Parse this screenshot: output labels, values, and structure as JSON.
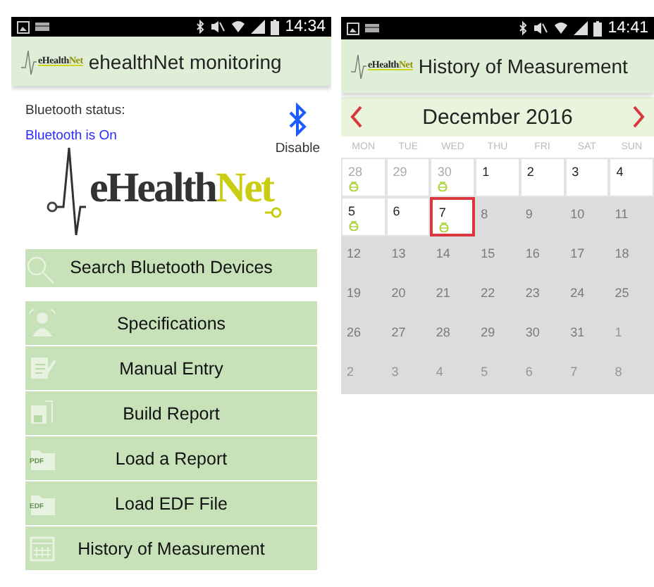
{
  "left_screen": {
    "status_bar": {
      "time": "14:34"
    },
    "header": {
      "logo": {
        "text": "eHealth",
        "accent": "Net"
      },
      "title": "ehealthNet monitoring"
    },
    "bluetooth": {
      "label": "Bluetooth status:",
      "status": "Bluetooth is On",
      "action": "Disable"
    },
    "logo": {
      "text": "eHealth",
      "accent": "Net"
    },
    "search_button": {
      "label": "Search Bluetooth Devices"
    },
    "menu": [
      {
        "label": "Specifications",
        "kind": "person"
      },
      {
        "label": "Manual Entry",
        "kind": "edit"
      },
      {
        "label": "Build Report",
        "kind": "disk"
      },
      {
        "label": "Load a Report",
        "kind": "folder",
        "icon_text": "PDF"
      },
      {
        "label": "Load EDF File",
        "kind": "folder",
        "icon_text": "EDF"
      },
      {
        "label": "History of Measurement",
        "kind": "calendar"
      }
    ]
  },
  "right_screen": {
    "status_bar": {
      "time": "14:41"
    },
    "header": {
      "logo": {
        "text": "eHealth",
        "accent": "Net"
      },
      "title": "History of Measurement"
    },
    "calendar": {
      "month": "December 2016",
      "weekdays": [
        "MON",
        "TUE",
        "WED",
        "THU",
        "FRI",
        "SAT",
        "SUN"
      ],
      "days": [
        {
          "day": "28",
          "outside": true,
          "disabled": false,
          "marked": true,
          "selected": false
        },
        {
          "day": "29",
          "outside": true,
          "disabled": false,
          "marked": false,
          "selected": false
        },
        {
          "day": "30",
          "outside": true,
          "disabled": false,
          "marked": true,
          "selected": false
        },
        {
          "day": "1",
          "outside": false,
          "disabled": false,
          "marked": false,
          "selected": false
        },
        {
          "day": "2",
          "outside": false,
          "disabled": false,
          "marked": false,
          "selected": false
        },
        {
          "day": "3",
          "outside": false,
          "disabled": false,
          "marked": false,
          "selected": false
        },
        {
          "day": "4",
          "outside": false,
          "disabled": false,
          "marked": false,
          "selected": false
        },
        {
          "day": "5",
          "outside": false,
          "disabled": false,
          "marked": true,
          "selected": false
        },
        {
          "day": "6",
          "outside": false,
          "disabled": false,
          "marked": false,
          "selected": false
        },
        {
          "day": "7",
          "outside": false,
          "disabled": false,
          "marked": true,
          "selected": true
        },
        {
          "day": "8",
          "outside": false,
          "disabled": true,
          "marked": false,
          "selected": false
        },
        {
          "day": "9",
          "outside": false,
          "disabled": true,
          "marked": false,
          "selected": false
        },
        {
          "day": "10",
          "outside": false,
          "disabled": true,
          "marked": false,
          "selected": false
        },
        {
          "day": "11",
          "outside": false,
          "disabled": true,
          "marked": false,
          "selected": false
        },
        {
          "day": "12",
          "outside": false,
          "disabled": true,
          "marked": false,
          "selected": false
        },
        {
          "day": "13",
          "outside": false,
          "disabled": true,
          "marked": false,
          "selected": false
        },
        {
          "day": "14",
          "outside": false,
          "disabled": true,
          "marked": false,
          "selected": false
        },
        {
          "day": "15",
          "outside": false,
          "disabled": true,
          "marked": false,
          "selected": false
        },
        {
          "day": "16",
          "outside": false,
          "disabled": true,
          "marked": false,
          "selected": false
        },
        {
          "day": "17",
          "outside": false,
          "disabled": true,
          "marked": false,
          "selected": false
        },
        {
          "day": "18",
          "outside": false,
          "disabled": true,
          "marked": false,
          "selected": false
        },
        {
          "day": "19",
          "outside": false,
          "disabled": true,
          "marked": false,
          "selected": false
        },
        {
          "day": "20",
          "outside": false,
          "disabled": true,
          "marked": false,
          "selected": false
        },
        {
          "day": "21",
          "outside": false,
          "disabled": true,
          "marked": false,
          "selected": false
        },
        {
          "day": "22",
          "outside": false,
          "disabled": true,
          "marked": false,
          "selected": false
        },
        {
          "day": "23",
          "outside": false,
          "disabled": true,
          "marked": false,
          "selected": false
        },
        {
          "day": "24",
          "outside": false,
          "disabled": true,
          "marked": false,
          "selected": false
        },
        {
          "day": "25",
          "outside": false,
          "disabled": true,
          "marked": false,
          "selected": false
        },
        {
          "day": "26",
          "outside": false,
          "disabled": true,
          "marked": false,
          "selected": false
        },
        {
          "day": "27",
          "outside": false,
          "disabled": true,
          "marked": false,
          "selected": false
        },
        {
          "day": "28",
          "outside": false,
          "disabled": true,
          "marked": false,
          "selected": false
        },
        {
          "day": "29",
          "outside": false,
          "disabled": true,
          "marked": false,
          "selected": false
        },
        {
          "day": "30",
          "outside": false,
          "disabled": true,
          "marked": false,
          "selected": false
        },
        {
          "day": "31",
          "outside": false,
          "disabled": true,
          "marked": false,
          "selected": false
        },
        {
          "day": "1",
          "outside": true,
          "disabled": true,
          "marked": false,
          "selected": false
        },
        {
          "day": "2",
          "outside": true,
          "disabled": true,
          "marked": false,
          "selected": false
        },
        {
          "day": "3",
          "outside": true,
          "disabled": true,
          "marked": false,
          "selected": false
        },
        {
          "day": "4",
          "outside": true,
          "disabled": true,
          "marked": false,
          "selected": false
        },
        {
          "day": "5",
          "outside": true,
          "disabled": true,
          "marked": false,
          "selected": false
        },
        {
          "day": "6",
          "outside": true,
          "disabled": true,
          "marked": false,
          "selected": false
        },
        {
          "day": "7",
          "outside": true,
          "disabled": true,
          "marked": false,
          "selected": false
        },
        {
          "day": "8",
          "outside": true,
          "disabled": true,
          "marked": false,
          "selected": false
        }
      ]
    }
  }
}
